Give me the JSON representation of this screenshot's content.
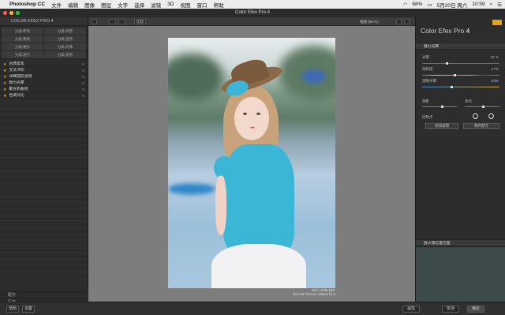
{
  "menubar": {
    "app": "Photoshop CC",
    "items": [
      "文件",
      "编辑",
      "图像",
      "图层",
      "文字",
      "选择",
      "滤镜",
      "3D",
      "视图",
      "窗口",
      "帮助"
    ],
    "battery": "68%",
    "date": "5月20日 周六",
    "time": "10:59"
  },
  "window": {
    "title": "Color Efex Pro 4"
  },
  "left_panel": {
    "header": "COLOR EFEX PRO 4",
    "categories": [
      "分类:所有",
      "分类:风景",
      "分类:建筑",
      "分类:自然",
      "分类:婚礼",
      "分类:肖像",
      "分类:游行",
      "分类:旅游"
    ],
    "filters": [
      "古典柔焦",
      "交叉冲印",
      "详细提取滤镜",
      "魅力光晕",
      "聚光和曲线",
      "色调对比"
    ],
    "bottom": [
      "配方",
      "历史"
    ]
  },
  "toolbar": {
    "compare": "比较",
    "zoom": "缩放 (58 %)"
  },
  "photo": {
    "filename": "DSC_3285.NEF",
    "meta": "30.2 MP  ISO 64, 1/500s f/4.0"
  },
  "right_panel": {
    "title": "Color Efex Pro",
    "version": "4",
    "section": "魅力光晕",
    "sliders": [
      {
        "label": "光晕",
        "value": "32 %",
        "fraction": 0.32
      },
      {
        "label": "饱和度",
        "value": "-17%",
        "fraction": 0.42
      },
      {
        "label": "温暖光晕",
        "value": "-23%",
        "fraction": 0.38
      }
    ],
    "shadow": "阴影",
    "highlight": "亮点",
    "control_points": "控制点",
    "add_filter": "添加滤镜",
    "save_recipe": "保存配方",
    "loupe": "放大镜与直方图"
  },
  "bottom": {
    "help": "帮助",
    "settings": "设置",
    "brush": "画笔",
    "cancel": "取消",
    "ok": "确定"
  },
  "colors": {
    "accent": "#e3a21c",
    "panel": "#2c2c2c",
    "canvas": "#7d7d7d"
  }
}
